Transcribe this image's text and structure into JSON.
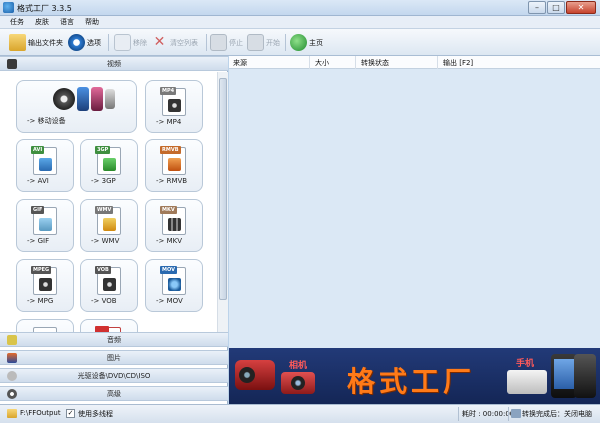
{
  "window": {
    "title": "格式工厂 3.3.5"
  },
  "menu": [
    "任务",
    "皮肤",
    "语言",
    "帮助"
  ],
  "toolbar": {
    "output_folder": "输出文件夹",
    "options": "选项",
    "remove": "移除",
    "clear_list": "清空列表",
    "stop": "停止",
    "start": "开始",
    "home": "主页"
  },
  "categories": {
    "video": "视频",
    "audio": "音频",
    "picture": "图片",
    "rom": "光驱设备\\DVD\\CD\\ISO",
    "advanced": "高级"
  },
  "video_tiles": [
    {
      "label": "-> 移动设备",
      "badge": ""
    },
    {
      "label": "-> MP4",
      "badge": "MP4"
    },
    {
      "label": "-> AVI",
      "badge": "AVI"
    },
    {
      "label": "-> 3GP",
      "badge": "3GP"
    },
    {
      "label": "-> RMVB",
      "badge": "RMVB"
    },
    {
      "label": "-> GIF",
      "badge": "GIF"
    },
    {
      "label": "-> WMV",
      "badge": "WMV"
    },
    {
      "label": "-> MKV",
      "badge": "MKV"
    },
    {
      "label": "-> MPG",
      "badge": "MPEG"
    },
    {
      "label": "-> VOB",
      "badge": "VOB"
    },
    {
      "label": "-> MOV",
      "badge": "MOV"
    }
  ],
  "task_list": {
    "columns": [
      "来源",
      "大小",
      "转换状态",
      "输出 [F2]"
    ]
  },
  "banner": {
    "camera_label": "相机",
    "brand_text": "格式工厂",
    "phone_label": "手机"
  },
  "status": {
    "output_path": "F:\\FFOutput",
    "multithread": "使用多线程",
    "elapsed": "耗时 : 00:00:00",
    "after_convert": "转换完成后：关闭电脑"
  },
  "colors": {
    "accent": "#ff7a18",
    "banner_bg": "#1a2f66",
    "list_bg": "#dbe8f5"
  }
}
